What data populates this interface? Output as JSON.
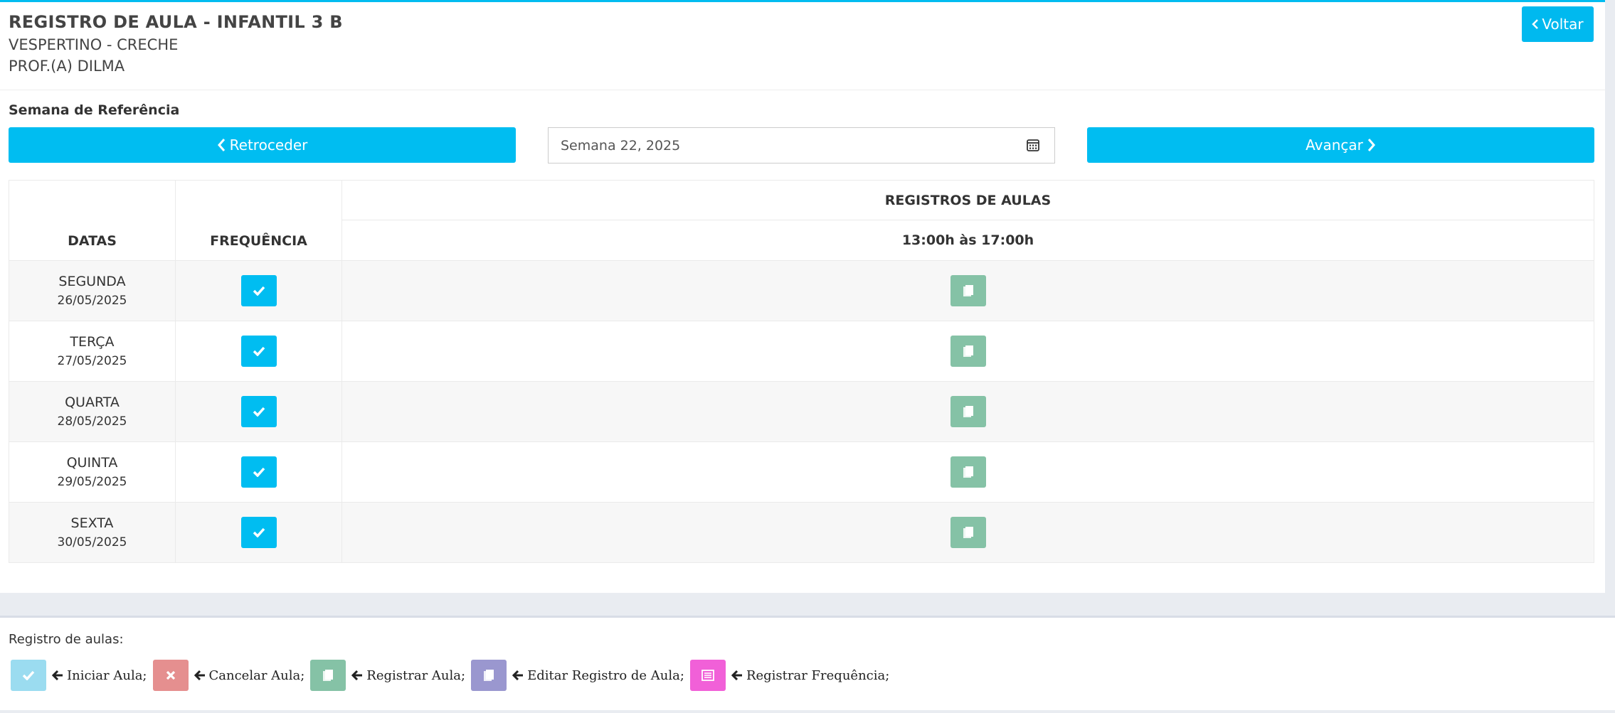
{
  "header": {
    "title": "REGISTRO DE AULA - INFANTIL 3 B",
    "subtitle": "VESPERTINO - CRECHE",
    "teacher": "PROF.(A) DILMA",
    "back_label": "Voltar"
  },
  "week": {
    "label": "Semana de Referência",
    "prev_label": "Retroceder",
    "next_label": "Avançar",
    "value": "Semana 22, 2025"
  },
  "table": {
    "col_dates": "DATAS",
    "col_freq": "FREQUÊNCIA",
    "col_records": "REGISTROS DE AULAS",
    "period": "13:00h às 17:00h",
    "rows": [
      {
        "day": "SEGUNDA",
        "date": "26/05/2025"
      },
      {
        "day": "TERÇA",
        "date": "27/05/2025"
      },
      {
        "day": "QUARTA",
        "date": "28/05/2025"
      },
      {
        "day": "QUINTA",
        "date": "29/05/2025"
      },
      {
        "day": "SEXTA",
        "date": "30/05/2025"
      }
    ]
  },
  "legend": {
    "title": "Registro de aulas:",
    "items": [
      {
        "label": "Iniciar Aula;",
        "icon": "check-icon",
        "color": "#9bdcf0"
      },
      {
        "label": "Cancelar Aula;",
        "icon": "close-icon",
        "color": "#e58f8f"
      },
      {
        "label": "Registrar Aula;",
        "icon": "copy-icon",
        "color": "#85c2a6"
      },
      {
        "label": "Editar Registro de Aula;",
        "icon": "copy-icon",
        "color": "#9a97cf"
      },
      {
        "label": "Registrar Frequência;",
        "icon": "list-icon",
        "color": "#f160d8"
      }
    ]
  },
  "colors": {
    "accent": "#00bdf1",
    "register": "#85c2a6"
  }
}
